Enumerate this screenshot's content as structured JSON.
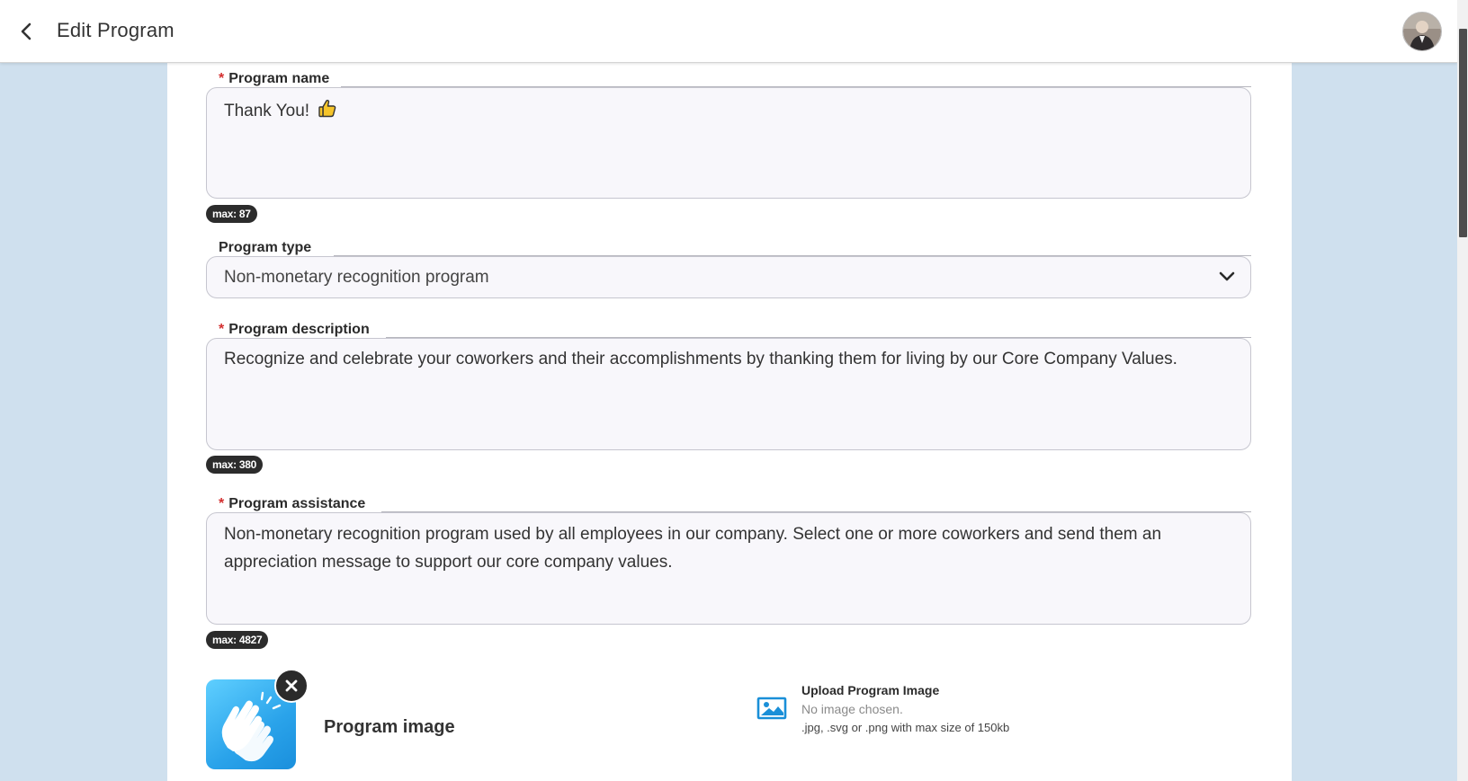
{
  "header": {
    "title": "Edit Program"
  },
  "form": {
    "program_name": {
      "label": "Program name",
      "required_mark": "*",
      "value": "Thank You!",
      "max": "max: 87"
    },
    "program_type": {
      "label": "Program type",
      "selected": "Non-monetary recognition program"
    },
    "program_description": {
      "label": "Program description",
      "required_mark": "*",
      "value": "Recognize and celebrate your coworkers and their accomplishments by thanking them for living by our Core Company Values.",
      "max": "max: 380"
    },
    "program_assistance": {
      "label": "Program assistance",
      "required_mark": "*",
      "value": "Non-monetary recognition program used by all employees in our company. Select one or more coworkers and send them an appreciation message to support our core company values.",
      "max": "max: 4827"
    },
    "program_image": {
      "label": "Program image",
      "upload_title": "Upload Program Image",
      "upload_status": "No image chosen.",
      "upload_hint": ".jpg, .svg or .png with max size of 150kb"
    }
  },
  "icons": {
    "back": "chevron-left-icon",
    "thumbs_up": "thumbs-up-icon",
    "dropdown": "chevron-down-icon",
    "remove": "close-icon",
    "upload": "image-icon",
    "program_image": "clapping-hands-icon"
  },
  "colors": {
    "page_background": "#cfe0ee",
    "required": "#d32f2f",
    "badge": "#2c2c2c",
    "image_tile": "#2aa3ea",
    "upload_icon": "#1a8fd8"
  }
}
